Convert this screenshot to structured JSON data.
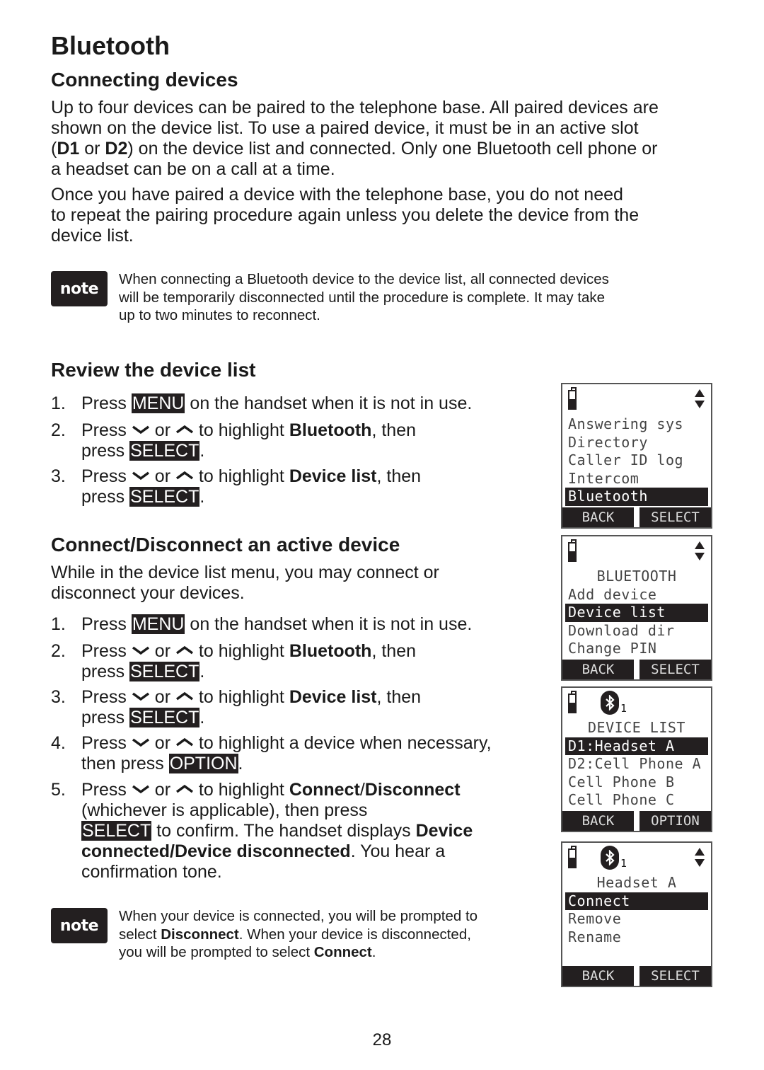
{
  "page": {
    "title": "Bluetooth",
    "page_number": "28"
  },
  "section_connecting": {
    "heading": "Connecting devices",
    "para1": [
      "Up to four devices can be paired to the telephone base. All paired devices are",
      "shown on the device list. To use a paired device, it must be in an active slot",
      "(D1 or D2) on the device list and connected. Only one Bluetooth cell phone or",
      "a headset can be on a call at a time."
    ],
    "para2": [
      "Once you have paired a device with the telephone base, you do not need",
      "to repeat the pairing procedure again unless you delete the device from the",
      "device list."
    ],
    "note_label": "note",
    "note": [
      "When connecting a Bluetooth device to the device list, all connected devices",
      "will be temporarily disconnected until the procedure is complete. It may take",
      "up to two minutes to reconnect."
    ]
  },
  "section_review": {
    "heading": "Review the device list",
    "steps": [
      {
        "num": "1.",
        "pre": "Press ",
        "key": "MENU",
        "post": " on the handset when it is not in use."
      },
      {
        "num": "2.",
        "pre": "Press ",
        "mid": " or ",
        "post1": " to highlight ",
        "bold": "Bluetooth",
        "post2": ", then",
        "line2_pre": "press ",
        "key": "SELECT",
        "line2_post": "."
      },
      {
        "num": "3.",
        "pre": "Press ",
        "mid": " or ",
        "post1": " to highlight ",
        "bold": "Device list",
        "post2": ", then",
        "line2_pre": "press ",
        "key": "SELECT",
        "line2_post": "."
      }
    ]
  },
  "section_connect": {
    "heading": "Connect/Disconnect an active device",
    "intro": [
      "While in the device list menu, you may connect or",
      "disconnect your devices."
    ],
    "steps": [
      {
        "num": "1.",
        "pre": "Press ",
        "key": "MENU",
        "post": " on the handset when it is not in use."
      },
      {
        "num": "2.",
        "pre": "Press ",
        "mid": " or ",
        "post1": " to highlight ",
        "bold": "Bluetooth",
        "post2": ", then",
        "line2_pre": "press ",
        "key": "SELECT",
        "line2_post": "."
      },
      {
        "num": "3.",
        "pre": "Press ",
        "mid": " or ",
        "post1": " to highlight ",
        "bold": "Device list",
        "post2": ", then",
        "line2_pre": "press ",
        "key": "SELECT",
        "line2_post": "."
      },
      {
        "num": "4.",
        "pre": "Press ",
        "mid": " or ",
        "post1": " to highlight a device when necessary,",
        "line2_pre": "then press ",
        "key": "OPTION",
        "line2_post": "."
      },
      {
        "num": "5.",
        "pre": "Press ",
        "mid": " or ",
        "post1": " to highlight ",
        "bold": "Connect",
        "slash": "/",
        "bold2": "Disconnect",
        "line2": "(whichever is applicable), then press",
        "key": "SELECT",
        "line3_post": " to confirm. The handset displays ",
        "line3_bold": "Device",
        "line4_bold": "connected/Device disconnected",
        "line4_post": ". You hear a",
        "line5": "confirmation tone."
      }
    ],
    "note_label": "note",
    "note": {
      "l1": "When your device is connected, you will be prompted to",
      "l2_pre": "select ",
      "l2_bold": "Disconnect",
      "l2_post": ". When your device is disconnected,",
      "l3_pre": "you will be prompted to select ",
      "l3_bold": "Connect",
      "l3_post": "."
    }
  },
  "screens": [
    {
      "lines": [
        "Answering sys",
        "Directory",
        "Caller ID log",
        "Intercom",
        "Bluetooth"
      ],
      "highlight": 4,
      "softkeys": [
        "BACK",
        "SELECT"
      ]
    },
    {
      "title": "BLUETOOTH",
      "lines": [
        "Add device",
        "Device list",
        "Download dir",
        "Change PIN"
      ],
      "highlight": 1,
      "softkeys": [
        "BACK",
        "SELECT"
      ]
    },
    {
      "bt_count": "1",
      "title": "DEVICE LIST",
      "lines": [
        "D1:Headset A",
        "D2:Cell Phone A",
        "Cell Phone B",
        "Cell Phone C"
      ],
      "highlight": 0,
      "softkeys": [
        "BACK",
        "OPTION"
      ]
    },
    {
      "bt_count": "1",
      "title": "Headset A",
      "lines": [
        "Connect",
        "Remove",
        "Rename"
      ],
      "highlight": 0,
      "softkeys": [
        "BACK",
        "SELECT"
      ]
    }
  ],
  "icons": {
    "down": "chevron-down-icon",
    "up": "chevron-up-icon",
    "battery": "battery-icon",
    "scroll": "scroll-arrows-icon",
    "bluetooth": "bluetooth-icon"
  }
}
